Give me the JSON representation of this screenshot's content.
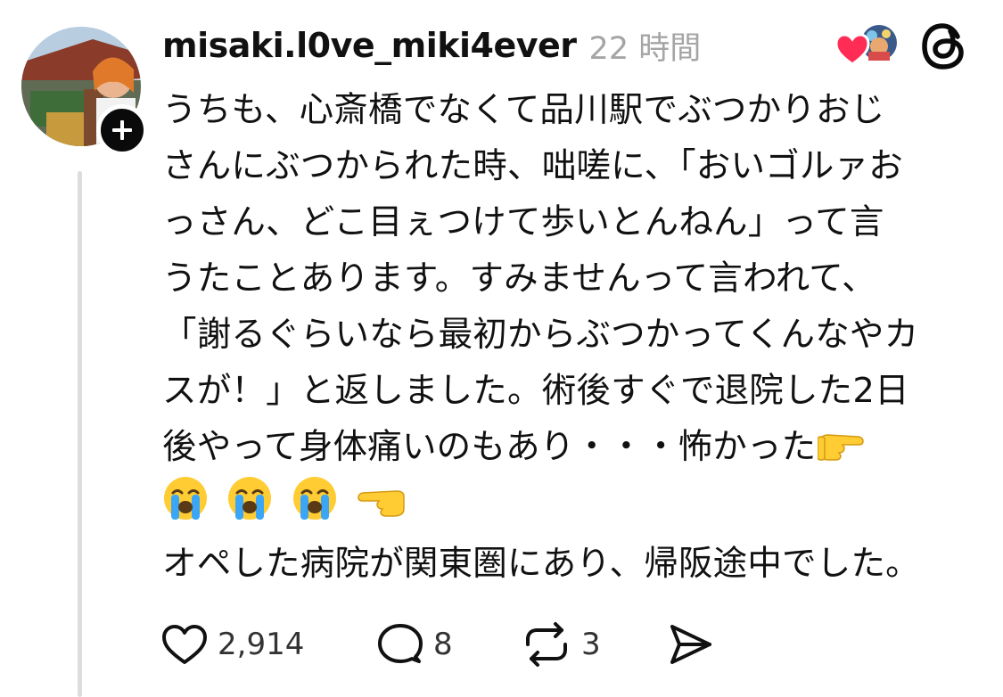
{
  "post": {
    "username": "misaki.l0ve_miki4ever",
    "timestamp": "22 時間",
    "lines": [
      "うちも、心斎橋でなくて品川駅でぶつかりおじ",
      "さんにぶつかられた時、咄嗟に、「おいゴルァお",
      "っさん、どこ目ぇつけて歩いとんねん」って言",
      "うたことあります。すみませんって言われて、",
      "「謝るぐらいなら最初からぶつかってくんなやカ",
      "スが！」と返しました。術後すぐで退院した2日",
      "後やって身体痛いのもあり・・・怖かった",
      "",
      "オペした病院が関東圏にあり、帰阪途中でした。"
    ],
    "emoji_line": [
      "loudly-crying-face",
      "loudly-crying-face",
      "loudly-crying-face",
      "backhand-index-pointing-left"
    ],
    "line7_trailing_emoji": "backhand-index-pointing-right"
  },
  "actions": {
    "likes": "2,914",
    "replies": "8",
    "reposts": "3"
  },
  "icons": {
    "like": "heart-icon",
    "reply": "comment-icon",
    "repost": "repost-icon",
    "share": "send-icon",
    "app_logo": "threads-logo-icon",
    "follow": "plus-icon"
  },
  "colors": {
    "text": "#111111",
    "muted": "#a5a5a5",
    "like_red": "#ff2d55",
    "emoji_yellow": "#ffcc33",
    "emoji_tear": "#3ba6f5"
  }
}
